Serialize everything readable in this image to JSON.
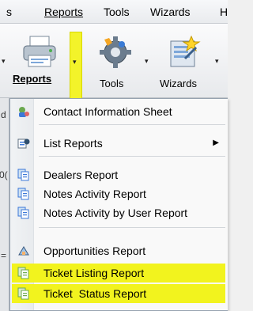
{
  "menubar": {
    "items": [
      {
        "label": "s",
        "mnemonic": ""
      },
      {
        "label": "Reports"
      },
      {
        "label": "Tools"
      },
      {
        "label": "Wizards"
      },
      {
        "label": "H"
      }
    ]
  },
  "toolbar": {
    "reports_label": "Reports",
    "tools_label": "Tools",
    "wizards_label": "Wizards",
    "caret": "▾",
    "highlight_color": "#f3f32a"
  },
  "leftstrip": {
    "chars": [
      "d",
      "0(",
      "="
    ]
  },
  "dropdown": {
    "items": [
      {
        "label": "Contact Information Sheet",
        "icon": "contact-sheet-icon"
      },
      {
        "label": "List Reports",
        "icon": "list-reports-icon",
        "submenu": true,
        "arrow": "▶"
      },
      {
        "label": "Dealers Report",
        "icon": "report-pages-icon"
      },
      {
        "label": "Notes Activity Report",
        "icon": "report-pages-icon"
      },
      {
        "label": "Notes Activity by User Report",
        "icon": "report-pages-icon"
      },
      {
        "label": "Opportunities Report",
        "icon": "opportunities-icon"
      },
      {
        "label": "Ticket Listing Report",
        "icon": "ticket-report-icon",
        "highlighted": true
      },
      {
        "label": "Ticket  Status Report",
        "icon": "ticket-report-icon",
        "highlighted": true
      }
    ]
  }
}
